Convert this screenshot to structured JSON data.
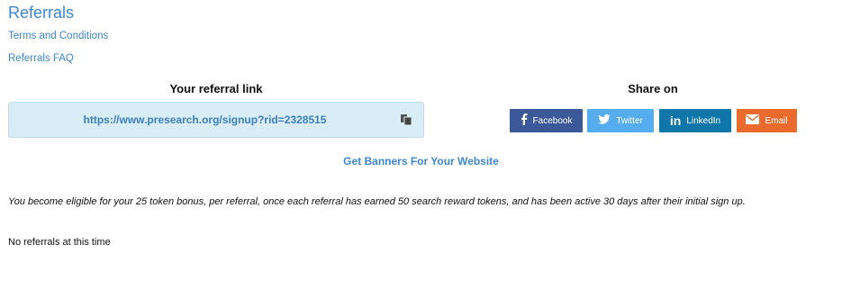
{
  "header": {
    "title": "Referrals"
  },
  "links": {
    "terms": "Terms and Conditions",
    "faq": "Referrals FAQ"
  },
  "referral": {
    "label": "Your referral link",
    "url": "https://www.presearch.org/signup?rid=2328515",
    "copy_icon": "copy-icon"
  },
  "share": {
    "label": "Share on",
    "buttons": [
      {
        "label": "Facebook",
        "icon": "facebook-icon",
        "color": "#3b5998"
      },
      {
        "label": "Twitter",
        "icon": "twitter-icon",
        "color": "#55acee"
      },
      {
        "label": "LinkedIn",
        "icon": "linkedin-icon",
        "color": "#0e76a8"
      },
      {
        "label": "Email",
        "icon": "email-icon",
        "color": "#eb6b2e"
      }
    ]
  },
  "banners_link": "Get Banners For Your Website",
  "eligibility_text": "You become eligible for your 25 token bonus, per referral, once each referral has earned 50 search reward tokens, and has been active 30 days after their initial sign up.",
  "empty_state": "No referrals at this time",
  "colors": {
    "accent": "#3d86d3",
    "link_box_bg": "#d9edf7"
  }
}
